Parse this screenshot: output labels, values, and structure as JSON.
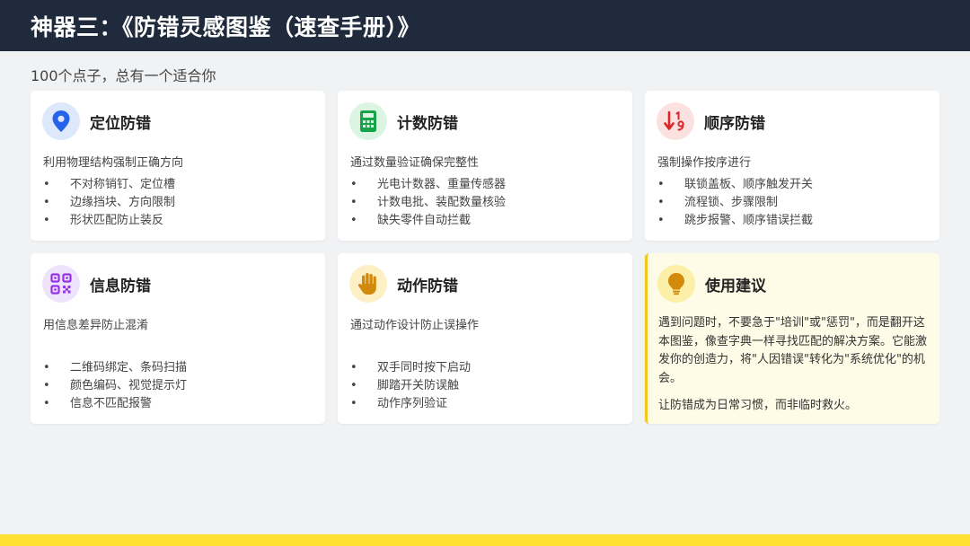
{
  "header": {
    "title": "神器三：《防错灵感图鉴（速查手册）》"
  },
  "subtitle": "100个点子，总有一个适合你",
  "colors": {
    "header_bg": "#1f2a3c",
    "accent_yellow": "#ffe033",
    "advice_border": "#f5c518"
  },
  "cards": [
    {
      "title": "定位防错",
      "icon": "location-pin-icon",
      "desc": "利用物理结构强制正确方向",
      "bullets": [
        "不对称销钉、定位槽",
        "边缘挡块、方向限制",
        "形状匹配防止装反"
      ]
    },
    {
      "title": "计数防错",
      "icon": "calculator-icon",
      "desc": "通过数量验证确保完整性",
      "bullets": [
        "光电计数器、重量传感器",
        "计数电批、装配数量核验",
        "缺失零件自动拦截"
      ]
    },
    {
      "title": "顺序防错",
      "icon": "sort-order-icon",
      "desc": "强制操作按序进行",
      "bullets": [
        "联锁盖板、顺序触发开关",
        "流程锁、步骤限制",
        "跳步报警、顺序错误拦截"
      ]
    },
    {
      "title": "信息防错",
      "icon": "qr-code-icon",
      "desc": "用信息差异防止混淆",
      "bullets": [
        "二维码绑定、条码扫描",
        "颜色编码、视觉提示灯",
        "信息不匹配报警"
      ]
    },
    {
      "title": "动作防错",
      "icon": "hand-icon",
      "desc": "通过动作设计防止误操作",
      "bullets": [
        "双手同时按下启动",
        "脚踏开关防误触",
        "动作序列验证"
      ]
    }
  ],
  "advice": {
    "title": "使用建议",
    "icon": "lightbulb-icon",
    "text1": "遇到问题时，不要急于\"培训\"或\"惩罚\"，而是翻开这本图鉴，像查字典一样寻找匹配的解决方案。它能激发你的创造力，将\"人因错误\"转化为\"系统优化\"的机会。",
    "text2": "让防错成为日常习惯，而非临时救火。"
  },
  "bullet_symbol": "•"
}
